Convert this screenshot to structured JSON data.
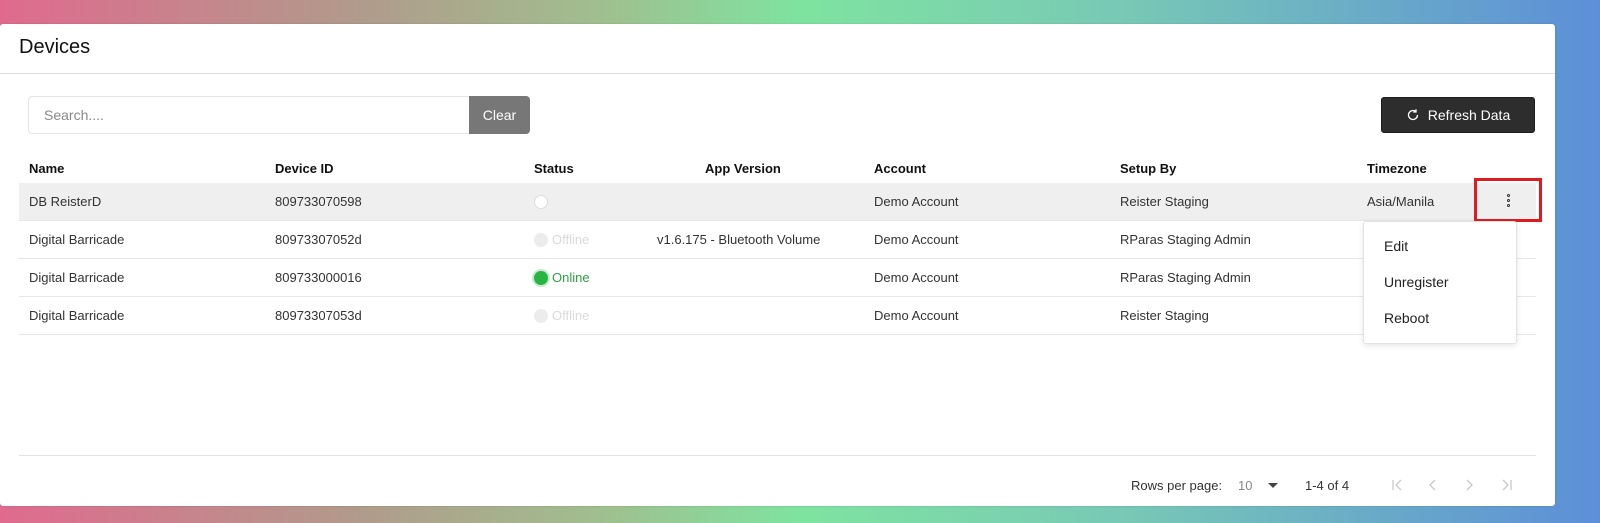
{
  "page": {
    "title": "Devices"
  },
  "search": {
    "placeholder": "Search....",
    "clear_label": "Clear"
  },
  "toolbar": {
    "refresh_label": "Refresh Data"
  },
  "table": {
    "columns": [
      "Name",
      "Device ID",
      "Status",
      "App Version",
      "Account",
      "Setup By",
      "Timezone"
    ],
    "rows": [
      {
        "name": "DB ReisterD",
        "device_id": "809733070598",
        "status": "",
        "status_kind": "empty",
        "app_version": "",
        "account": "Demo Account",
        "setup_by": "Reister Staging",
        "timezone": "Asia/Manila"
      },
      {
        "name": "Digital Barricade",
        "device_id": "80973307052d",
        "status": "Offline",
        "status_kind": "offline",
        "app_version": "v1.6.175 - Bluetooth Volume",
        "account": "Demo Account",
        "setup_by": "RParas Staging Admin",
        "timezone": ""
      },
      {
        "name": "Digital Barricade",
        "device_id": "809733000016",
        "status": "Online",
        "status_kind": "online",
        "app_version": "",
        "account": "Demo Account",
        "setup_by": "RParas Staging Admin",
        "timezone": ""
      },
      {
        "name": "Digital Barricade",
        "device_id": "80973307053d",
        "status": "Offline",
        "status_kind": "offline",
        "app_version": "",
        "account": "Demo Account",
        "setup_by": "Reister Staging",
        "timezone": ""
      }
    ]
  },
  "row_menu": {
    "items": [
      "Edit",
      "Unregister",
      "Reboot"
    ]
  },
  "pagination": {
    "rows_per_page_label": "Rows per page:",
    "rows_per_page_value": "10",
    "range": "1-4 of 4"
  },
  "colors": {
    "online": "#27b443",
    "highlight": "#e01a22",
    "dark_button": "#2d2d2d",
    "clear_button": "#777777"
  },
  "icons": {
    "refresh": "refresh-icon",
    "more": "more-vertical-icon",
    "first": "first-page-icon",
    "prev": "prev-page-icon",
    "next": "next-page-icon",
    "last": "last-page-icon"
  }
}
